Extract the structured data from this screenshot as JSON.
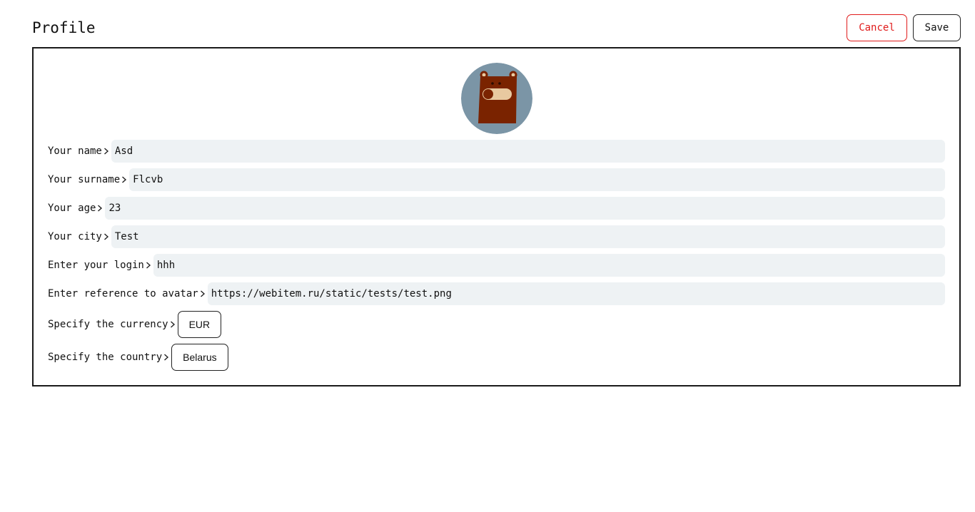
{
  "header": {
    "title": "Profile",
    "cancel_label": "Cancel",
    "save_label": "Save"
  },
  "colors": {
    "cancel": "#e01b1b",
    "input_background": "#eef2f4",
    "avatar_background": "#7b95a6",
    "bear_body": "#7a2300"
  },
  "avatar": {
    "icon": "bear-avatar-icon"
  },
  "fields": [
    {
      "label": "Your name",
      "value": "Asd"
    },
    {
      "label": "Your surname",
      "value": "Flcvb"
    },
    {
      "label": "Your age",
      "value": "23"
    },
    {
      "label": "Your city",
      "value": "Test"
    },
    {
      "label": "Enter your login",
      "value": "hhh"
    },
    {
      "label": "Enter reference to avatar",
      "value": "https://webitem.ru/static/tests/test.png"
    }
  ],
  "currency": {
    "label": "Specify the currency",
    "value": "EUR"
  },
  "country": {
    "label": "Specify the country",
    "value": "Belarus"
  }
}
